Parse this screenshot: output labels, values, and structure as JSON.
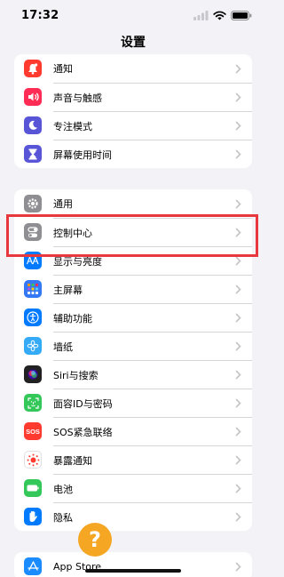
{
  "status_bar": {
    "time": "17:32"
  },
  "nav": {
    "title": "设置"
  },
  "groups": [
    [
      {
        "label": "通知",
        "icon": "bell-icon",
        "color": "#ff3b30"
      },
      {
        "label": "声音与触感",
        "icon": "speaker-icon",
        "color": "#ff2d55"
      },
      {
        "label": "专注模式",
        "icon": "moon-icon",
        "color": "#5856d6"
      },
      {
        "label": "屏幕使用时间",
        "icon": "hourglass-icon",
        "color": "#5856d6"
      }
    ],
    [
      {
        "label": "通用",
        "icon": "gear-icon",
        "color": "#8e8e93"
      },
      {
        "label": "控制中心",
        "icon": "toggles-icon",
        "color": "#8e8e93"
      },
      {
        "label": "显示与亮度",
        "icon": "text-size-icon",
        "color": "#007aff"
      },
      {
        "label": "主屏幕",
        "icon": "home-grid-icon",
        "color": "#3478f6"
      },
      {
        "label": "辅助功能",
        "icon": "accessibility-icon",
        "color": "#007aff"
      },
      {
        "label": "墙纸",
        "icon": "flower-icon",
        "color": "#35aaf6"
      },
      {
        "label": "Siri与搜索",
        "icon": "siri-icon",
        "color": "#222222"
      },
      {
        "label": "面容ID与密码",
        "icon": "faceid-icon",
        "color": "#34c759"
      },
      {
        "label": "SOS紧急联络",
        "icon": "sos-icon",
        "color": "#ff3b30"
      },
      {
        "label": "暴露通知",
        "icon": "exposure-icon",
        "color": "#ffffff"
      },
      {
        "label": "电池",
        "icon": "battery-icon",
        "color": "#34c759"
      },
      {
        "label": "隐私",
        "icon": "hand-icon",
        "color": "#007aff"
      }
    ],
    [
      {
        "label": "App Store",
        "icon": "appstore-icon",
        "color": "#1a8cff"
      }
    ]
  ]
}
